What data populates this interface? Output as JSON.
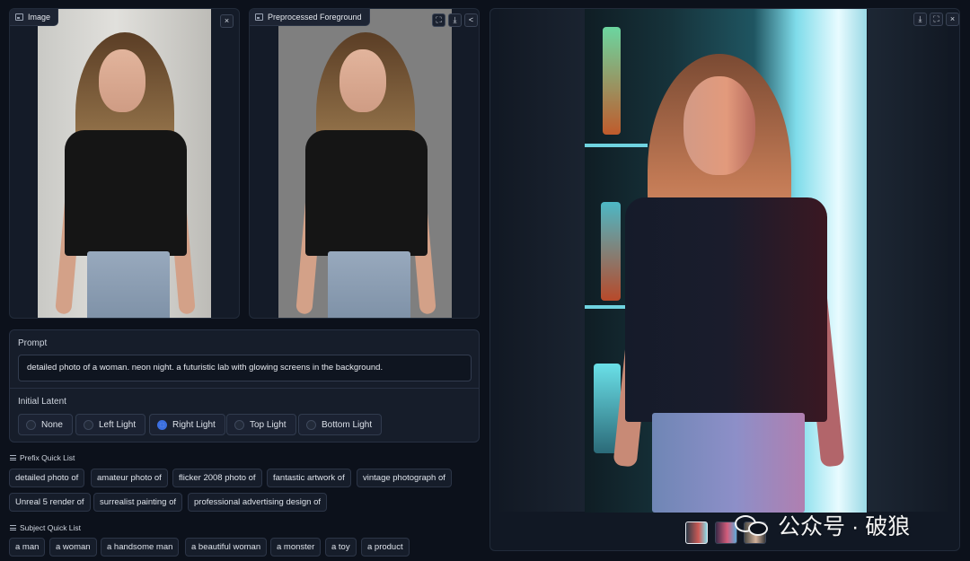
{
  "input_panel": {
    "label": "Image",
    "close_icon": "×"
  },
  "foreground_panel": {
    "label": "Preprocessed Foreground",
    "fullscreen_icon": "⛶",
    "download_icon": "⤓",
    "share_icon": "<"
  },
  "result_panel": {
    "download_icon": "⤓",
    "fullscreen_icon": "⛶",
    "close_icon": "×"
  },
  "prompt": {
    "label": "Prompt",
    "value": "detailed photo of a woman. neon night. a futuristic lab with glowing screens in the background."
  },
  "initial_latent": {
    "label": "Initial Latent",
    "options": [
      "None",
      "Left Light",
      "Right Light",
      "Top Light",
      "Bottom Light"
    ],
    "selected": "Right Light"
  },
  "prefix_quick_list": {
    "title": "Prefix Quick List",
    "items": [
      "detailed photo of",
      "amateur photo of",
      "flicker 2008 photo of",
      "fantastic artwork of",
      "vintage photograph of",
      "Unreal 5 render of",
      "surrealist painting of",
      "professional advertising design of"
    ]
  },
  "subject_quick_list": {
    "title": "Subject Quick List",
    "items": [
      "a man",
      "a woman",
      "a handsome man",
      "a beautiful woman",
      "a monster",
      "a toy",
      "a product"
    ]
  },
  "watermark": {
    "text": "公众号 · 破狼"
  },
  "colors": {
    "accent": "#3b6fe0",
    "background": "#0c111b",
    "panel": "#141b28",
    "neon_cyan": "#4ff0ff",
    "neon_red": "#ff4a4a"
  }
}
